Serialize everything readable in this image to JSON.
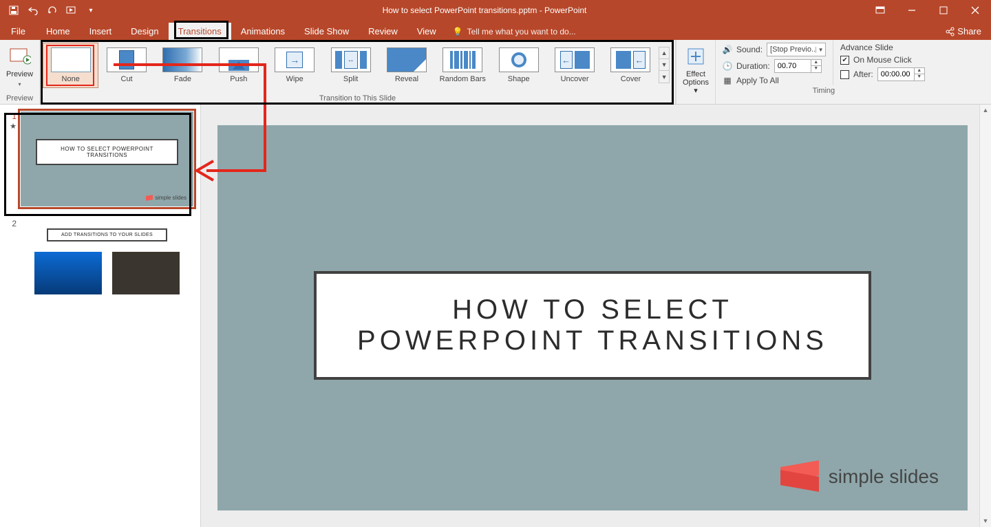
{
  "app": {
    "title": "How to select PowerPoint transitions.pptm - PowerPoint"
  },
  "qat": {
    "save": "save",
    "undo": "undo",
    "redo": "redo",
    "startover": "start-from-beginning"
  },
  "tabs": {
    "file": "File",
    "home": "Home",
    "insert": "Insert",
    "design": "Design",
    "transitions": "Transitions",
    "animations": "Animations",
    "slideshow": "Slide Show",
    "review": "Review",
    "view": "View",
    "tellme": "Tell me what you want to do...",
    "share": "Share"
  },
  "ribbon": {
    "preview": {
      "label": "Preview",
      "group": "Preview"
    },
    "gallery": {
      "group": "Transition to This Slide",
      "items": [
        {
          "label": "None"
        },
        {
          "label": "Cut"
        },
        {
          "label": "Fade"
        },
        {
          "label": "Push"
        },
        {
          "label": "Wipe"
        },
        {
          "label": "Split"
        },
        {
          "label": "Reveal"
        },
        {
          "label": "Random Bars"
        },
        {
          "label": "Shape"
        },
        {
          "label": "Uncover"
        },
        {
          "label": "Cover"
        }
      ]
    },
    "effectOptions": "Effect Options",
    "timing": {
      "group": "Timing",
      "sound": "Sound:",
      "soundValue": "[Stop Previo...",
      "duration": "Duration:",
      "durationValue": "00.70",
      "applyAll": "Apply To All",
      "advance": "Advance Slide",
      "onClick": "On Mouse Click",
      "after": "After:",
      "afterValue": "00:00.00"
    }
  },
  "thumbs": {
    "n1": "1",
    "n2": "2",
    "t1": "HOW TO SELECT POWERPOINT TRANSITIONS",
    "t2": "ADD TRANSITIONS TO YOUR SLIDES",
    "logo": "simple slides"
  },
  "slide": {
    "title": "HOW TO SELECT POWERPOINT TRANSITIONS",
    "logo": "simple slides"
  }
}
